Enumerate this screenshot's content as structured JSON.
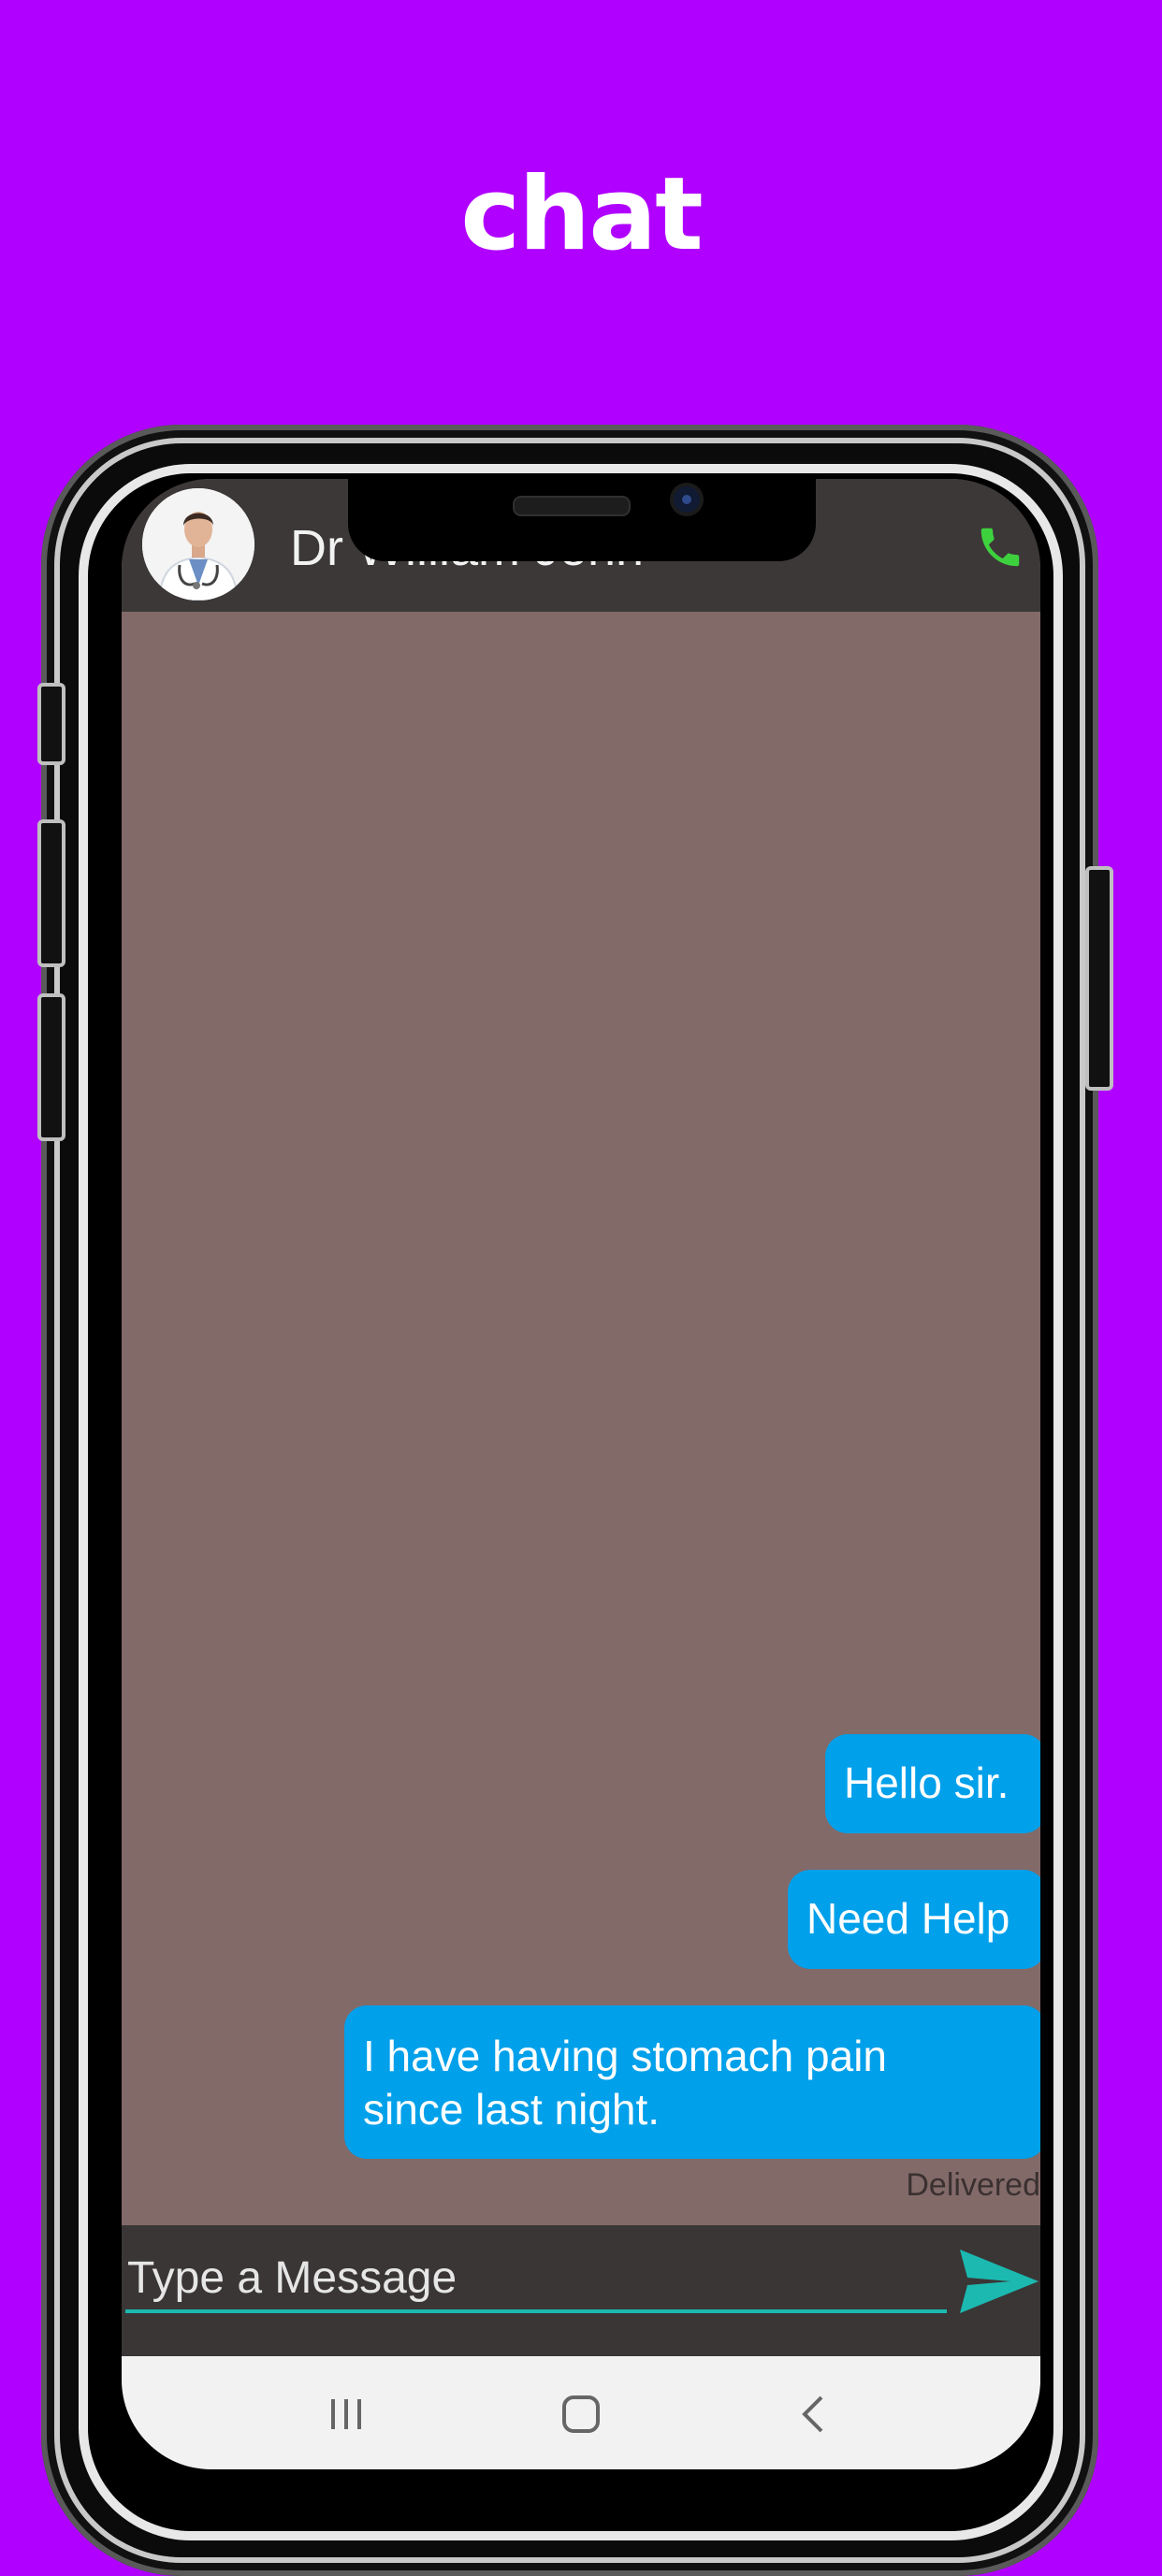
{
  "headline": "chat",
  "chat_header": {
    "contact_name": "Dr William John",
    "call_icon": "phone-icon",
    "avatar_icon": "doctor-avatar"
  },
  "messages": [
    {
      "text": "Hello sir.",
      "side": "sent"
    },
    {
      "text": "Need Help",
      "side": "sent"
    },
    {
      "text": "I have having stomach pain\nsince last night.",
      "side": "sent"
    }
  ],
  "status": "Delivered",
  "composer": {
    "placeholder": "Type a Message",
    "send_icon": "send-icon"
  },
  "navbar": {
    "recents_icon": "recent-apps-icon",
    "home_icon": "home-icon",
    "back_icon": "back-icon"
  },
  "colors": {
    "page_background": "#b000ff",
    "chat_background": "#826a69",
    "header_background": "#3c3838",
    "bubble": "#00a0ea",
    "accent": "#1bb9b0",
    "call_green": "#3ed13e"
  }
}
